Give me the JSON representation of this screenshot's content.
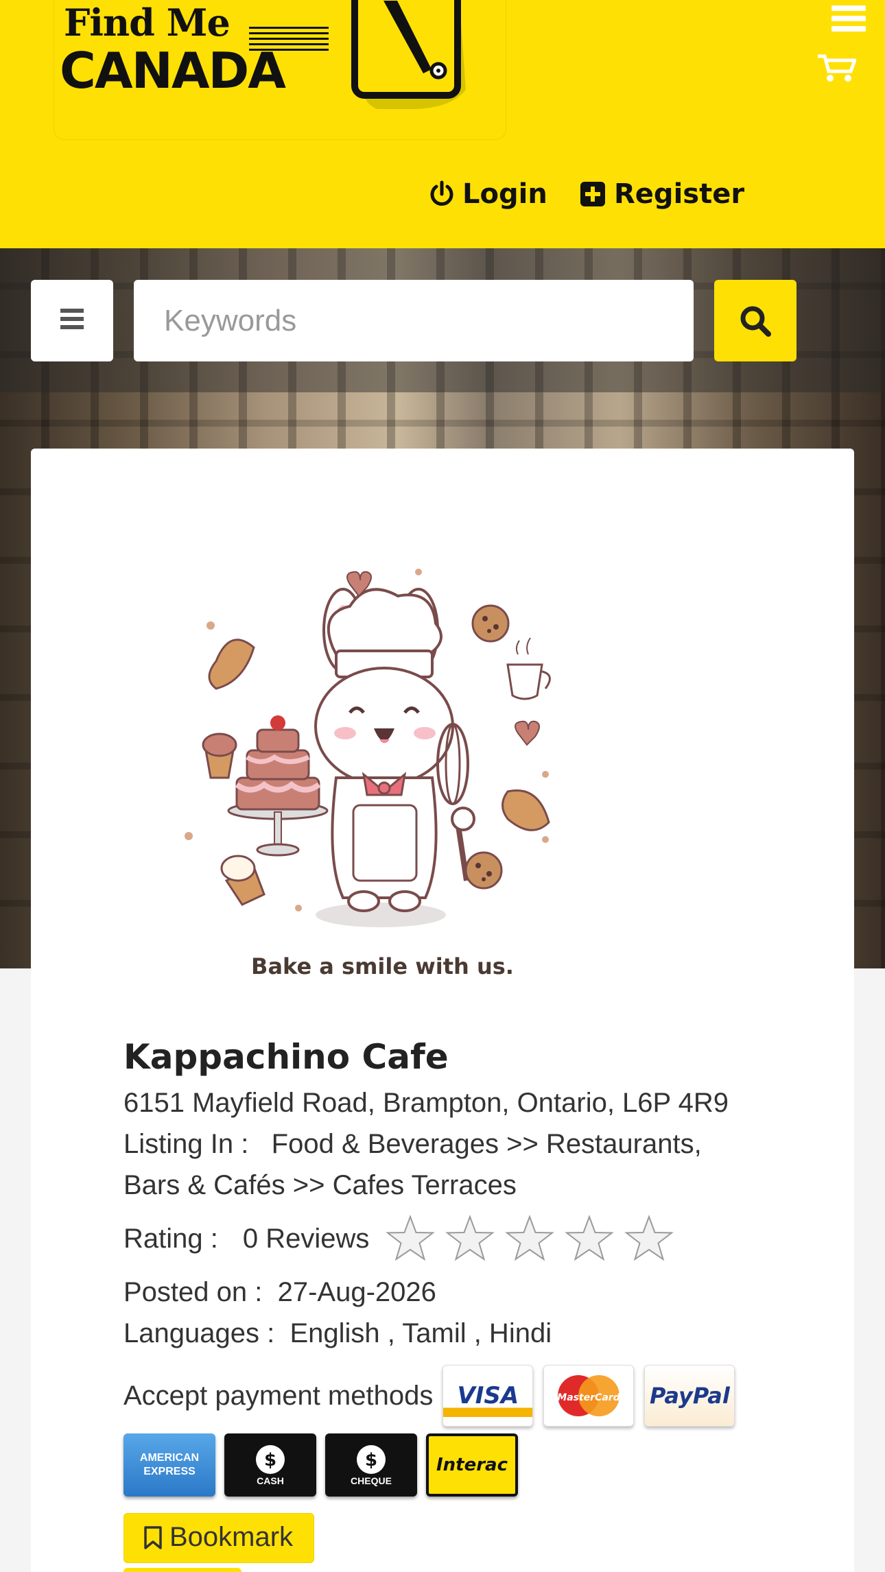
{
  "header": {
    "logo_line1": "Find Me",
    "logo_line2": "CANADA",
    "login_label": "Login",
    "register_label": "Register"
  },
  "search": {
    "placeholder": "Keywords"
  },
  "listing": {
    "tagline": "Bake a smile with us.",
    "name": "Kappachino Cafe",
    "address": "6151 Mayfield Road, Brampton, Ontario, L6P 4R9",
    "listing_in_label": "Listing In :",
    "listing_in_value_1": "Food & Beverages >> Restaurants,",
    "listing_in_value_2": "Bars & Cafés >> Cafes Terraces",
    "rating_label": "Rating :",
    "reviews": "0 Reviews",
    "rating_value": 0,
    "rating_max": 5,
    "posted_label": "Posted on :",
    "posted_value": "27-Aug-2026",
    "languages_label": "Languages :",
    "languages_value": "English , Tamil , Hindi",
    "payment_label": "Accept payment methods",
    "payments": [
      "VISA",
      "MasterCard",
      "PayPal",
      "AMERICAN EXPRESS",
      "CASH",
      "CHEQUE",
      "Interac"
    ],
    "bookmark_label": "Bookmark"
  },
  "colors": {
    "brand_yellow": "#ffe005",
    "text": "#333333"
  }
}
